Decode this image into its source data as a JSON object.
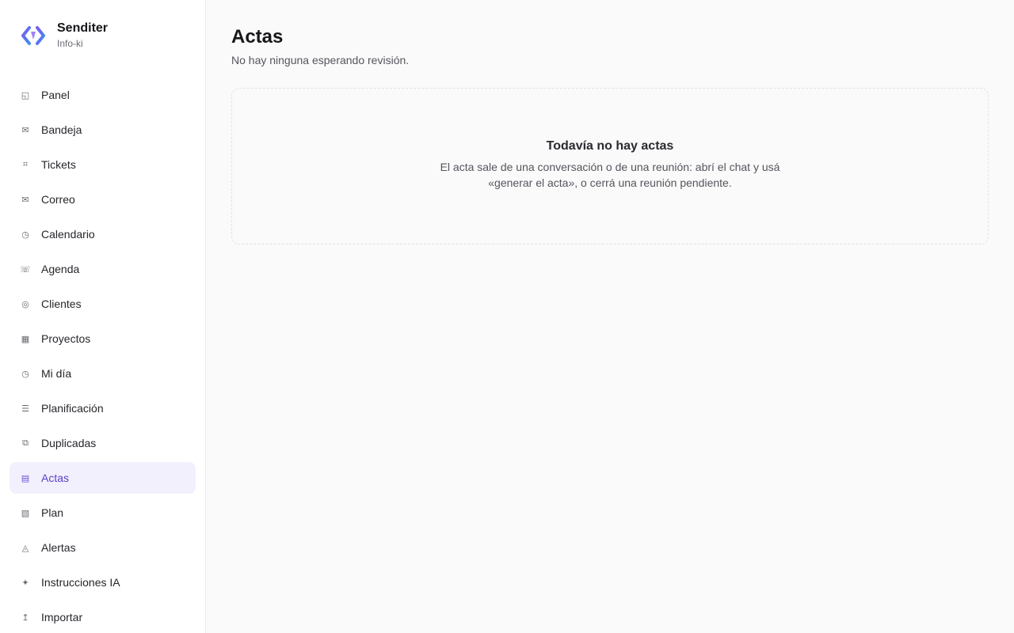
{
  "brand": {
    "name": "Senditer",
    "subtitle": "Info-ki",
    "logo_colors": [
      "#6d5be8",
      "#4f8df5"
    ]
  },
  "sidebar": {
    "active": "Actas",
    "accent": "#5b3fc9",
    "items": [
      {
        "label": "Panel",
        "icon": "panel-icon",
        "glyph": "◱"
      },
      {
        "label": "Bandeja",
        "icon": "inbox-icon",
        "glyph": "✉"
      },
      {
        "label": "Tickets",
        "icon": "ticket-icon",
        "glyph": "⌗"
      },
      {
        "label": "Correo",
        "icon": "mail-icon",
        "glyph": "✉"
      },
      {
        "label": "Calendario",
        "icon": "calendar-icon",
        "glyph": "◷"
      },
      {
        "label": "Agenda",
        "icon": "phone-icon",
        "glyph": "☏"
      },
      {
        "label": "Clientes",
        "icon": "clients-icon",
        "glyph": "◎"
      },
      {
        "label": "Proyectos",
        "icon": "projects-icon",
        "glyph": "▦"
      },
      {
        "label": "Mi día",
        "icon": "clock-icon",
        "glyph": "◷"
      },
      {
        "label": "Planificación",
        "icon": "list-icon",
        "glyph": "☰"
      },
      {
        "label": "Duplicadas",
        "icon": "duplicate-icon",
        "glyph": "⧉"
      },
      {
        "label": "Actas",
        "icon": "minutes-icon",
        "glyph": "▤"
      },
      {
        "label": "Plan",
        "icon": "plan-icon",
        "glyph": "▧"
      },
      {
        "label": "Alertas",
        "icon": "alert-icon",
        "glyph": "◬"
      },
      {
        "label": "Instrucciones IA",
        "icon": "sparkle-icon",
        "glyph": "✦"
      },
      {
        "label": "Importar",
        "icon": "import-icon",
        "glyph": "↥"
      }
    ]
  },
  "main": {
    "title": "Actas",
    "subtitle": "No hay ninguna esperando revisión.",
    "empty": {
      "title": "Todavía no hay actas",
      "description": "El acta sale de una conversación o de una reunión: abrí el chat y usá «generar el acta», o cerrá una reunión pendiente."
    }
  }
}
